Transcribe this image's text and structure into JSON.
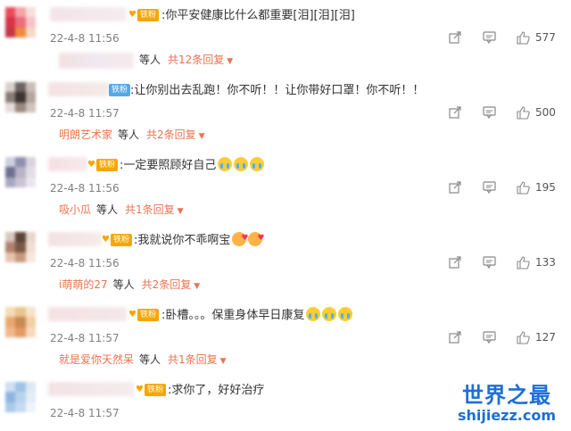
{
  "badge_label": "铁粉",
  "reply_suffix": "等人",
  "comments": [
    {
      "text": ":你平安健康比什么都重要[泪][泪][泪]",
      "time": "22-4-8 11:56",
      "likes": "577",
      "reply_user": "",
      "reply_total": "共12条回复"
    },
    {
      "text": ":让你别出去乱跑！你不听！！让你带好口罩！你不听！！",
      "time": "22-4-8 11:57",
      "likes": "500",
      "reply_user": "明朗艺术家",
      "reply_total": "共2条回复"
    },
    {
      "text": ":一定要照顾好自己",
      "time": "22-4-8 11:56",
      "likes": "195",
      "reply_user": "吸小瓜",
      "reply_total": "共1条回复"
    },
    {
      "text": ":我就说你不乖啊宝",
      "time": "22-4-8 11:56",
      "likes": "133",
      "reply_user": "i萌萌的27",
      "reply_total": "共2条回复"
    },
    {
      "text": ":卧槽。。。保重身体早日康复",
      "time": "22-4-8 11:57",
      "likes": "127",
      "reply_user": "就是爱你天然呆",
      "reply_total": "共1条回复"
    },
    {
      "text": ":求你了，好好治疗",
      "time": "22-4-8 11:57"
    }
  ],
  "watermark": {
    "title": "世界之最",
    "subtitle": "shijiezz.com"
  }
}
